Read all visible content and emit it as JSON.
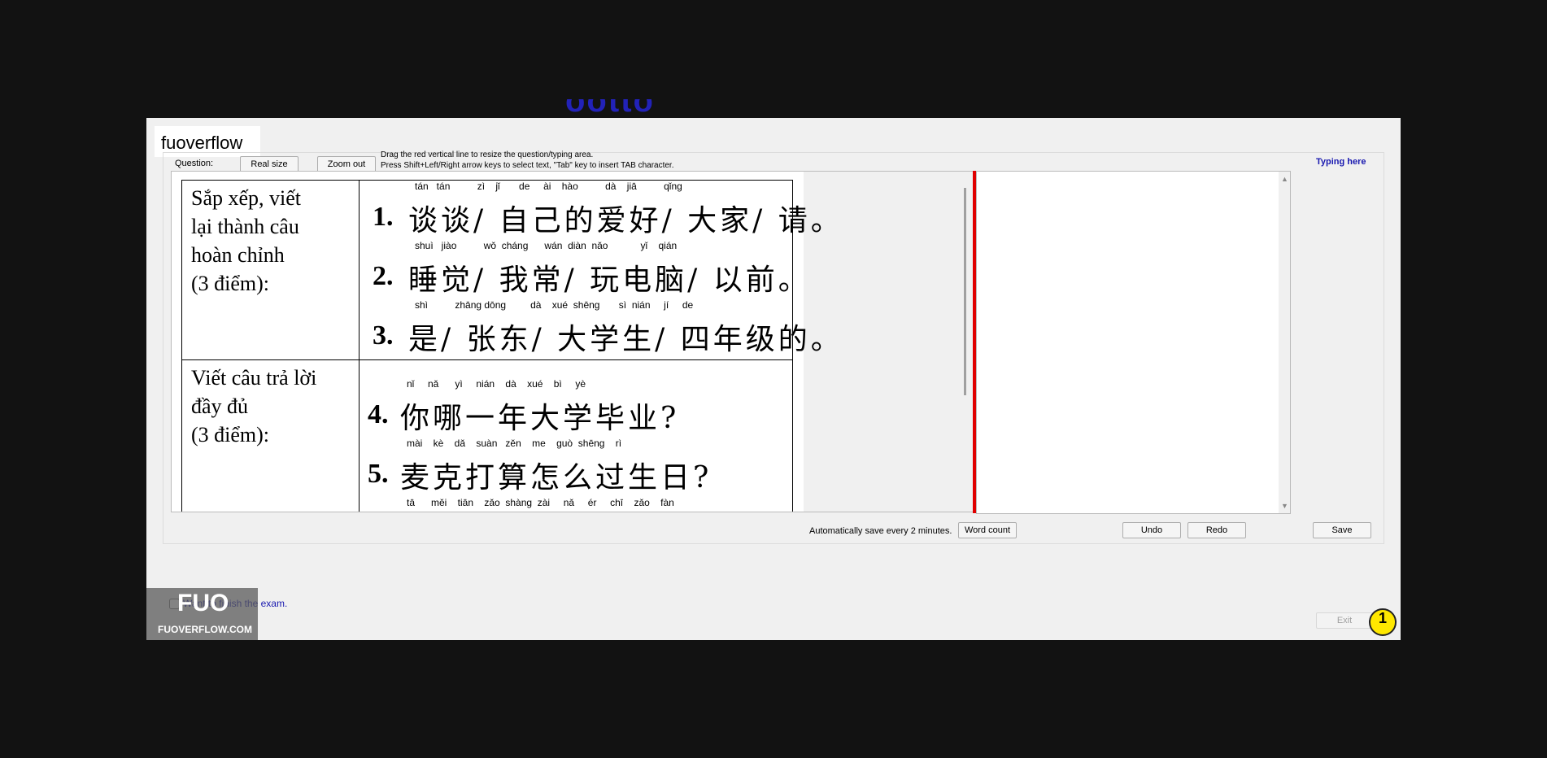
{
  "banner_fragment": "ootto",
  "brand": "fuoverflow",
  "toolbar": {
    "question_label": "Question:",
    "real_size": "Real size",
    "zoom_out": "Zoom out",
    "hint_line1": "Drag the red vertical line to resize the question/typing area.",
    "hint_line2": "Press Shift+Left/Right arrow keys to select text, \"Tab\" key to insert TAB character.",
    "typing_title": "Typing here"
  },
  "question": {
    "section1_label_lines": [
      "Sắp xếp, viết",
      "lại thành câu",
      "hoàn chỉnh",
      "(3 điểm):"
    ],
    "section2_label_lines": [
      "Viết câu trả lời",
      "đầy đủ",
      "(3 điểm):"
    ],
    "items": [
      {
        "num": "1.",
        "pinyin": "tán   tán          zì    jǐ       de     ài    hào          dà    jiā          qǐng",
        "text": "谈谈/ 自己的爱好/ 大家/ 请。"
      },
      {
        "num": "2.",
        "pinyin": "shuì   jiào          wǒ  cháng      wán  diàn  nǎo            yǐ    qián",
        "text": "睡觉/ 我常/ 玩电脑/ 以前。"
      },
      {
        "num": "3.",
        "pinyin": "shì          zhāng dōng         dà    xué  shēng       sì  nián     jí     de",
        "text": "是/ 张东/ 大学生/ 四年级的。"
      },
      {
        "num": "4.",
        "pinyin": "nǐ     nǎ      yì     nián    dà    xué    bì     yè",
        "text": "你哪一年大学毕业?"
      },
      {
        "num": "5.",
        "pinyin": "mài    kè    dǎ    suàn   zěn    me    guò  shēng    rì",
        "text": "麦克打算怎么过生日?"
      },
      {
        "num": "",
        "pinyin": "tā      měi    tiān    zǎo  shàng  zài     nǎ     ér     chī    zǎo    fàn",
        "text": ""
      }
    ]
  },
  "bottom": {
    "autosave": "Automatically save every 2 minutes.",
    "word_count": "Word count",
    "undo": "Undo",
    "redo": "Redo",
    "save": "Save"
  },
  "finish_label": "Want to finish the exam.",
  "exit": "Exit",
  "watermark": {
    "logo": "FUO",
    "site": "FUOVERFLOW.COM"
  },
  "step_badge": "1"
}
